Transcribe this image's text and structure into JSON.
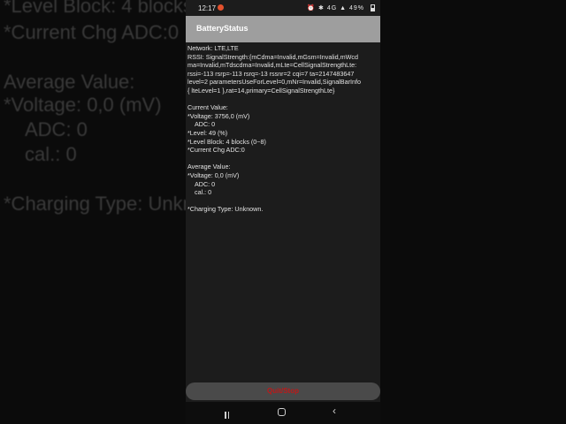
{
  "background_text": [
    "*Level Block: 4 blocks",
    "*Current Chg ADC:0",
    "Average Value:",
    "*Voltage:  0,0 (mV)",
    "ADC:  0",
    "cal.: 0",
    "*Charging Type: Unknown"
  ],
  "status_bar": {
    "time": "12:17",
    "battery": "49%",
    "icons": "⏰ ✱ 4G ▲"
  },
  "app_bar": {
    "title": "BatteryStatus"
  },
  "network": {
    "line1": "Network: LTE,LTE",
    "line2": "RSSI: SignalStrength:{mCdma=Invalid,mGsm=Invalid,mWcd",
    "line3": "ma=Invalid,mTdscdma=Invalid,mLte=CellSignalStrengthLte:",
    "line4": "rssi=-113 rsrp=-113 rsrq=-13 rssnr=2 cqi=7 ta=2147483647",
    "line5": "level=2 parametersUseForLevel=0,mNr=Invalid,SignalBarInfo",
    "line6": "{ lteLevel=1 },rat=14,primary=CellSignalStrengthLte}"
  },
  "current_value": {
    "heading": "Current Value:",
    "voltage": "*Voltage:  3756,0 (mV)",
    "adc": "ADC:  0",
    "level": "*Level: 49 (%)",
    "level_block": "*Level Block: 4 blocks (0~8)",
    "chg_adc": "*Current Chg ADC:0"
  },
  "average_value": {
    "heading": "Average Value:",
    "voltage": "*Voltage:  0,0 (mV)",
    "adc": "ADC:  0",
    "cal": "cal.: 0"
  },
  "charging_type": "*Charging Type: Unknown.",
  "quit_button": {
    "label": "Quit/Stop"
  },
  "colors": {
    "app_bar": "#9e9e9e",
    "background": "#1c1c1c",
    "quit_text": "#c01818"
  }
}
